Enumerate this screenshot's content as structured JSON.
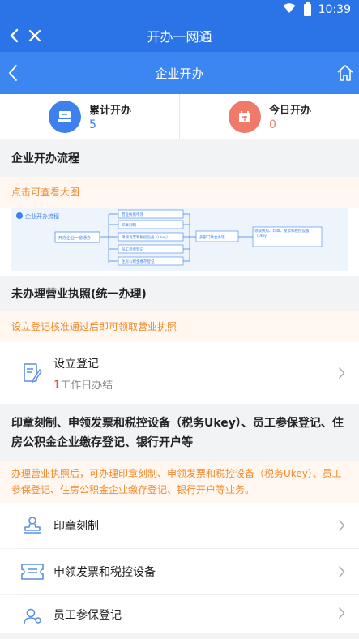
{
  "status": {
    "time": "10:39"
  },
  "appbar": {
    "title": "开办一网通"
  },
  "subbar": {
    "title": "企业开办"
  },
  "stats": [
    {
      "label": "累计开办",
      "value": "5",
      "color": "#3e80ec",
      "icon": "stamp-hand-icon"
    },
    {
      "label": "今日开办",
      "value": "0",
      "color": "#f07a6a",
      "icon": "calendar-icon"
    }
  ],
  "flow": {
    "title": "企业开办流程",
    "hint": "点击可查看大图",
    "diagram": {
      "logo": "企业开办流程",
      "start": "开办企业一窗通办",
      "mid": [
        "营业执照申领",
        "印章刻制",
        "申领发票和税控设备（Ukey）",
        "员工参保登记",
        "住房公积金缴存登记"
      ],
      "end1": "多部门联合办理",
      "end2": "领取执照、印章、发票和税控设备（Ukey）"
    }
  },
  "license": {
    "title": "未办理营业执照(统一办理)",
    "hint": "设立登记核准通过后即可领取营业执照",
    "item": {
      "label": "设立登记",
      "days": "1",
      "days_suffix": "工作日办结"
    }
  },
  "others": {
    "title": "印章刻制、申领发票和税控设备（税务Ukey）、员工参保登记、住房公积金企业缴存登记、银行开户等",
    "hint": "办理营业执照后，可办理印章刻制、申领发票和税控设备（税务Ukey）、员工参保登记、住房公积金企业缴存登记、银行开户等业务。",
    "items": [
      {
        "label": "印章刻制"
      },
      {
        "label": "申领发票和税控设备"
      },
      {
        "label": "员工参保登记"
      }
    ]
  }
}
